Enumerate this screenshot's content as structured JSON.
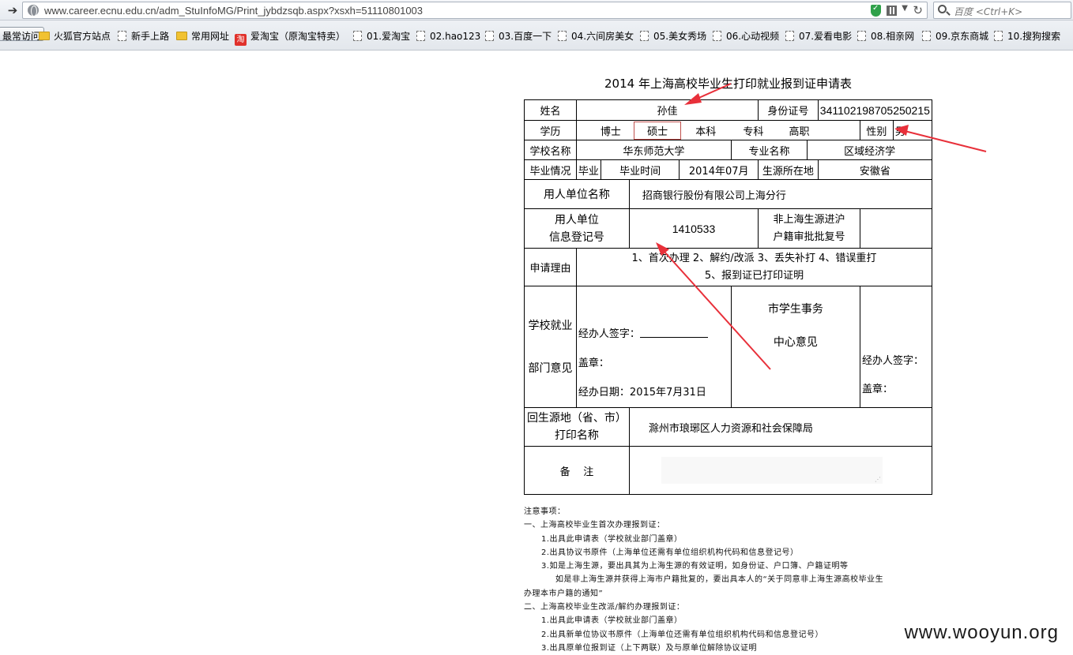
{
  "browser": {
    "url": "www.career.ecnu.edu.cn/adm_StuInfoMG/Print_jybdzsqb.aspx?xsxh=51110801003",
    "search_placeholder": "百度 <Ctrl+K>",
    "bookmarks": [
      {
        "label": "最常访问",
        "icon": "none"
      },
      {
        "label": "火狐官方站点",
        "icon": "folder-icon"
      },
      {
        "label": "新手上路",
        "icon": "page-icon"
      },
      {
        "label": "常用网址",
        "icon": "folder-icon"
      },
      {
        "label": "爱淘宝（原淘宝特卖）",
        "icon": "taobao-icon"
      },
      {
        "label": "01.爱淘宝",
        "icon": "page-icon"
      },
      {
        "label": "02.hao123",
        "icon": "page-icon"
      },
      {
        "label": "03.百度一下",
        "icon": "page-icon"
      },
      {
        "label": "04.六间房美女",
        "icon": "page-icon"
      },
      {
        "label": "05.美女秀场",
        "icon": "page-icon"
      },
      {
        "label": "06.心动视频",
        "icon": "page-icon"
      },
      {
        "label": "07.爱看电影",
        "icon": "page-icon"
      },
      {
        "label": "08.相亲网",
        "icon": "page-icon"
      },
      {
        "label": "09.京东商城",
        "icon": "page-icon"
      },
      {
        "label": "10.搜狗搜索",
        "icon": "page-icon"
      }
    ]
  },
  "form": {
    "title": "2014 年上海高校毕业生打印就业报到证申请表",
    "name_label": "姓名",
    "name_value": "孙佳",
    "id_label": "身份证号",
    "id_value": "341102198705250215",
    "education_label": "学历",
    "education_options": [
      "博士",
      "硕士",
      "本科",
      "专科",
      "高职"
    ],
    "education_selected": "硕士",
    "gender_label": "性别",
    "gender_value": "男",
    "school_label": "学校名称",
    "school_value": "华东师范大学",
    "major_label": "专业名称",
    "major_value": "区域经济学",
    "grad_status_label": "毕业情况",
    "grad_status_value": "毕业",
    "grad_time_label": "毕业时间",
    "grad_time_value": "2014年07月",
    "origin_label": "生源所在地",
    "origin_value": "安徽省",
    "employer_label": "用人单位名称",
    "employer_value": "招商银行股份有限公司上海分行",
    "employer_reg_label_1": "用人单位",
    "employer_reg_label_2": "信息登记号",
    "employer_reg_value": "1410533",
    "non_sh_label_1": "非上海生源进沪",
    "non_sh_label_2": "户籍审批批复号",
    "non_sh_value": "",
    "reason_label": "申请理由",
    "reason_line1": "1、首次办理 2、解约/改派  3、丢失补打  4、错误重打",
    "reason_line2": "5、报到证已打印证明",
    "school_dept_label_1": "学校就业",
    "school_dept_label_2": "部门意见",
    "handler_sign_label": "经办人签字：",
    "seal_label": "盖章：",
    "handle_date_label": "经办日期：2015年7月31日",
    "center_label_1": "市学生事务",
    "center_label_2": "中心意见",
    "center_sign_label": "经办人签字：",
    "center_seal_label": "盖章：",
    "print_name_label_1": "回生源地（省、市）",
    "print_name_label_2": "打印名称",
    "print_name_value": "滁州市琅琊区人力资源和社会保障局",
    "remarks_label": "备    注",
    "remarks_value": ""
  },
  "notes": {
    "heading": "注意事项：",
    "lines": [
      {
        "indent": 0,
        "text": "一、上海高校毕业生首次办理报到证："
      },
      {
        "indent": 1,
        "text": "1.出具此申请表（学校就业部门盖章）"
      },
      {
        "indent": 1,
        "text": "2.出具协议书原件（上海单位还需有单位组织机构代码和信息登记号）"
      },
      {
        "indent": 1,
        "text": "3.如是上海生源，要出具其为上海生源的有效证明，如身份证、户口簿、户籍证明等"
      },
      {
        "indent": 2,
        "text": "如是非上海生源并获得上海市户籍批复的，要出具本人的“关于同意非上海生源高校毕业生"
      },
      {
        "indent": 0,
        "text": "办理本市户籍的通知”"
      },
      {
        "indent": 0,
        "text": "二、上海高校毕业生改派/解约办理报到证："
      },
      {
        "indent": 1,
        "text": "1.出具此申请表（学校就业部门盖章）"
      },
      {
        "indent": 1,
        "text": "2.出具新单位协议书原件（上海单位还需有单位组织机构代码和信息登记号）"
      },
      {
        "indent": 1,
        "text": "3.出具原单位报到证（上下两联）及与原单位解除协议证明"
      }
    ]
  },
  "watermark": "www.wooyun.org",
  "colors": {
    "annotation_arrow": "#e8303a",
    "selected_border": "#c0504d"
  }
}
